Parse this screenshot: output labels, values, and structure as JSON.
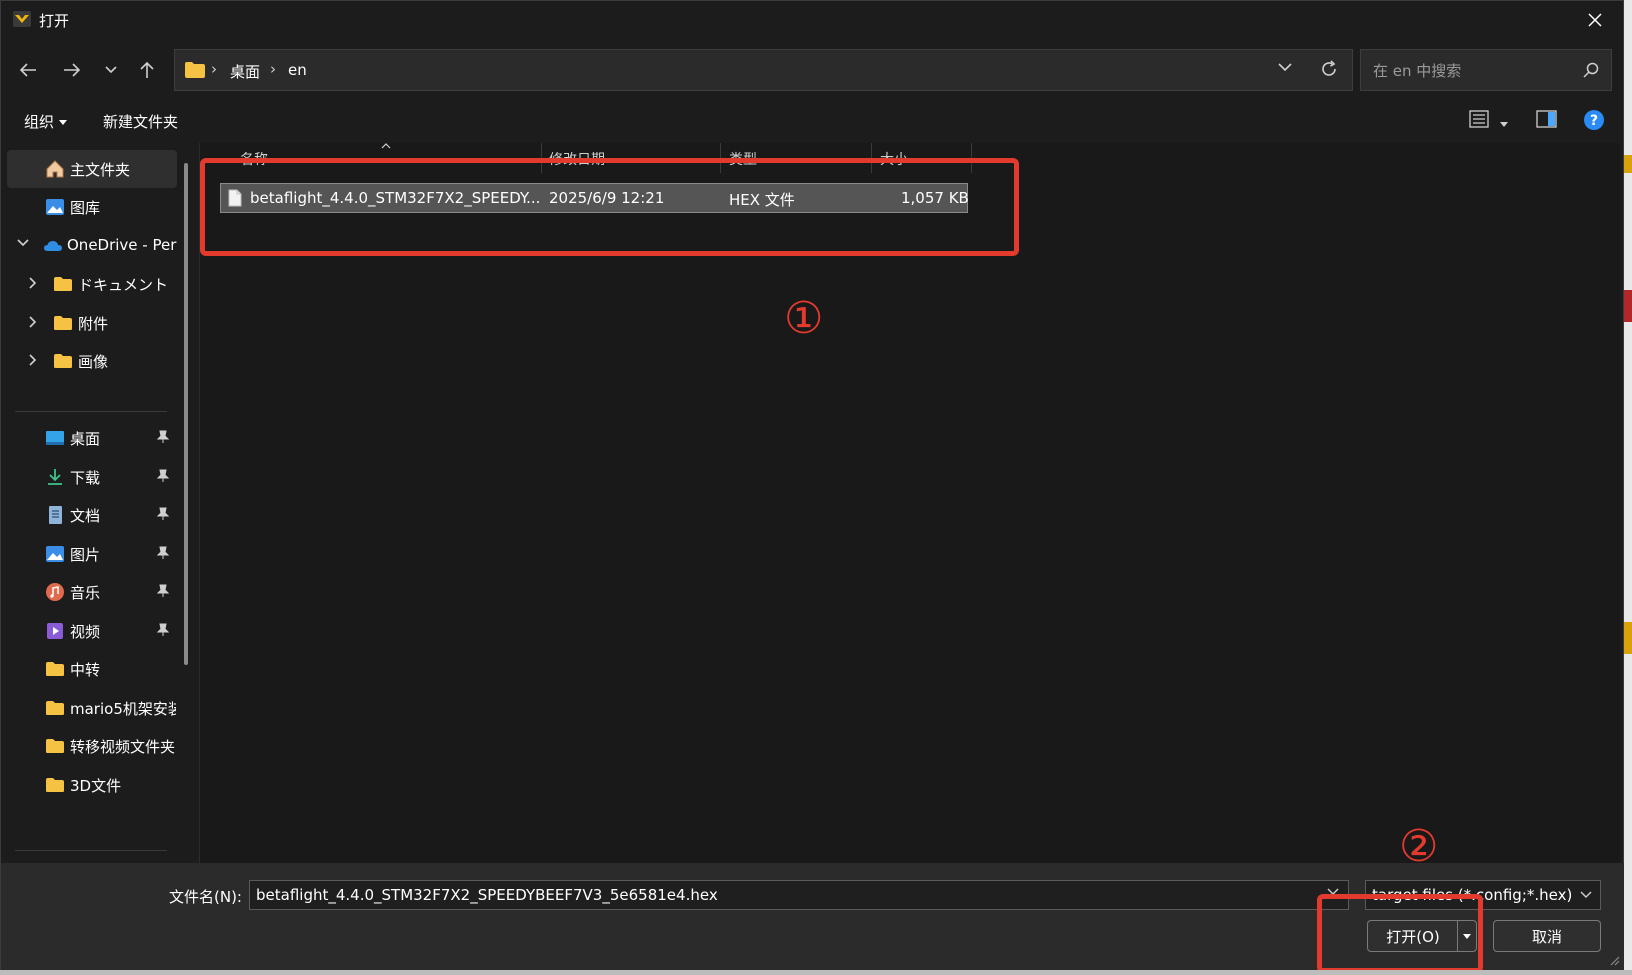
{
  "window": {
    "title": "打开"
  },
  "navigation": {
    "breadcrumbs": [
      "桌面",
      "en"
    ],
    "search_placeholder": "在 en 中搜索"
  },
  "toolbar": {
    "organize_label": "组织",
    "new_folder_label": "新建文件夹"
  },
  "sidebar": {
    "items": [
      {
        "label": "主文件夹",
        "icon": "home-icon"
      },
      {
        "label": "图库",
        "icon": "gallery-icon"
      },
      {
        "label": "OneDrive - Per",
        "icon": "cloud-icon",
        "expanded": true
      },
      {
        "label": "ドキュメント",
        "icon": "folder-icon"
      },
      {
        "label": "附件",
        "icon": "folder-icon"
      },
      {
        "label": "画像",
        "icon": "folder-icon"
      }
    ],
    "quick_access": [
      {
        "label": "桌面",
        "icon": "desktop-icon",
        "pinned": true
      },
      {
        "label": "下载",
        "icon": "download-icon",
        "pinned": true
      },
      {
        "label": "文档",
        "icon": "document-icon",
        "pinned": true
      },
      {
        "label": "图片",
        "icon": "pictures-icon",
        "pinned": true
      },
      {
        "label": "音乐",
        "icon": "music-icon",
        "pinned": true
      },
      {
        "label": "视频",
        "icon": "video-icon",
        "pinned": true
      },
      {
        "label": "中转",
        "icon": "folder-icon",
        "pinned": false
      },
      {
        "label": "mario5机架安装",
        "icon": "folder-icon",
        "pinned": false
      },
      {
        "label": "转移视频文件夹",
        "icon": "folder-icon",
        "pinned": false
      },
      {
        "label": "3D文件",
        "icon": "folder-icon",
        "pinned": false
      }
    ]
  },
  "file_list": {
    "columns": [
      "名称",
      "修改日期",
      "类型",
      "大小"
    ],
    "rows": [
      {
        "name": "betaflight_4.4.0_STM32F7X2_SPEEDY...",
        "modified": "2025/6/9 12:21",
        "type": "HEX 文件",
        "size": "1,057 KB"
      }
    ]
  },
  "annotations": {
    "marker_1": "①",
    "marker_2": "②"
  },
  "footer": {
    "filename_label": "文件名(N):",
    "filename_value": "betaflight_4.4.0_STM32F7X2_SPEEDYBEEF7V3_5e6581e4.hex",
    "filetype_value": "target files (*.config;*.hex)",
    "open_label": "打开(O)",
    "cancel_label": "取消"
  },
  "colors": {
    "annotation": "#e23b2e",
    "accent": "#0a84ff",
    "folder": "#f6c243"
  }
}
